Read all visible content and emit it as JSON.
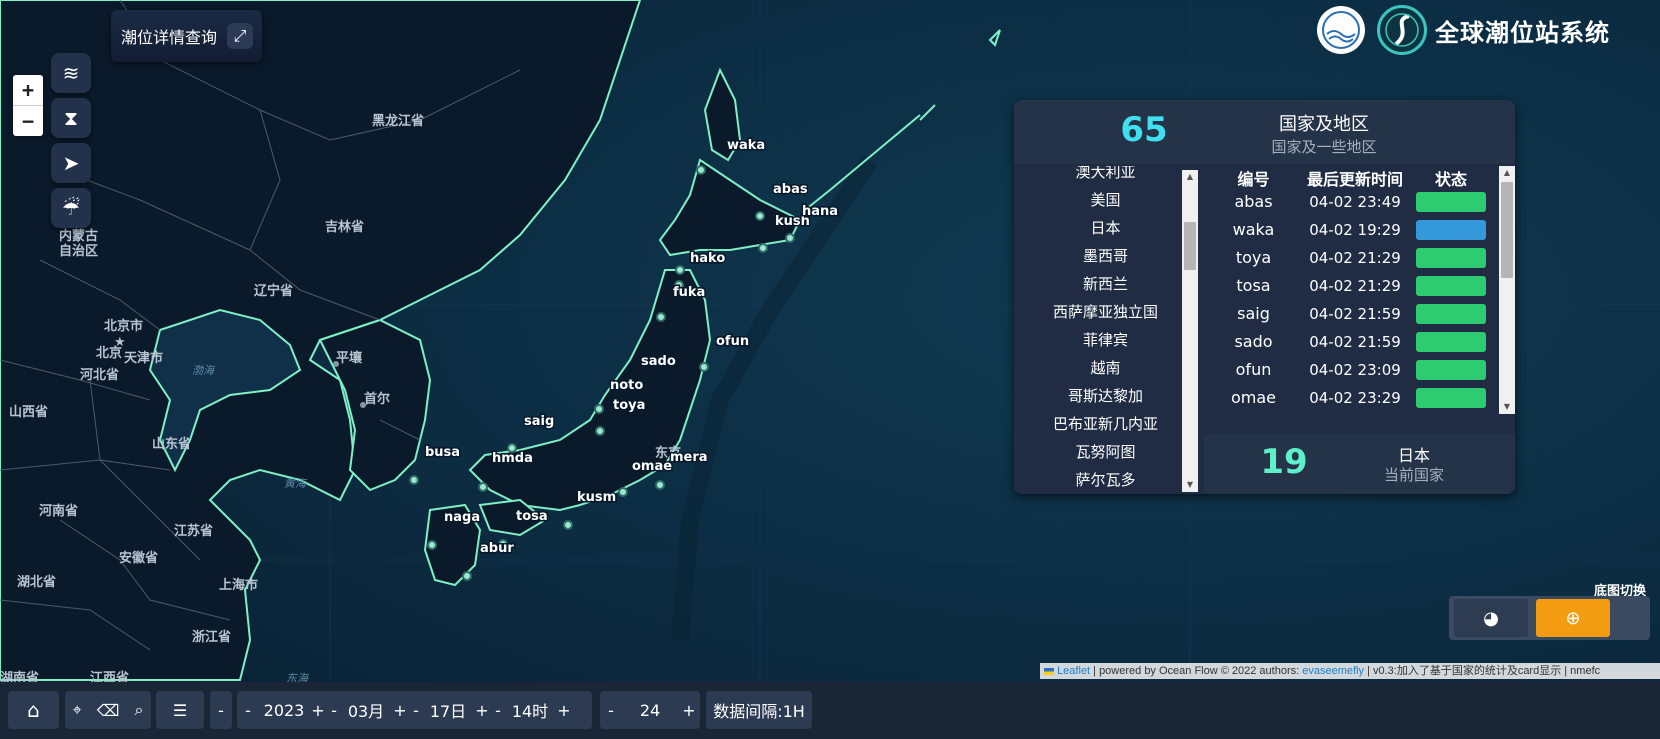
{
  "detail_button": {
    "label": "潮位详情查询",
    "icon": "expand-icon"
  },
  "zoom": {
    "in": "+",
    "out": "−"
  },
  "tools": [
    {
      "name": "tide-layer-icon",
      "glyph": "≋"
    },
    {
      "name": "hourglass-icon",
      "glyph": "⧗"
    },
    {
      "name": "navigate-icon",
      "glyph": "➤"
    },
    {
      "name": "typhoon-icon",
      "glyph": "☔"
    }
  ],
  "logo": {
    "title": "全球潮位站系统"
  },
  "places": {
    "heilongjiang": "黑龙江省",
    "jilin": "吉林省",
    "liaoning": "辽宁省",
    "neimenggu_1": "内蒙古",
    "neimenggu_2": "自治区",
    "beijing_city": "北京市",
    "beijing": "北京",
    "tianjin": "天津市",
    "hebei": "河北省",
    "shanxi": "山西省",
    "shandong": "山东省",
    "henan": "河南省",
    "jiangsu": "江苏省",
    "anhui": "安徽省",
    "hubei": "湖北省",
    "shanghai": "上海市",
    "zhejiang": "浙江省",
    "hunan": "湖南省",
    "jiangxi": "江西省",
    "pyongyang": "平壤",
    "seoul": "首尔",
    "tokyo": "东京",
    "bohai": "渤海",
    "huanghai": "黄海",
    "donghai": "东海"
  },
  "stations": [
    {
      "code": "waka"
    },
    {
      "code": "abas"
    },
    {
      "code": "kush"
    },
    {
      "code": "hana"
    },
    {
      "code": "hako"
    },
    {
      "code": "fuka"
    },
    {
      "code": "ofun"
    },
    {
      "code": "sado"
    },
    {
      "code": "noto"
    },
    {
      "code": "toya"
    },
    {
      "code": "saig"
    },
    {
      "code": "busa"
    },
    {
      "code": "hmda"
    },
    {
      "code": "mera"
    },
    {
      "code": "omae"
    },
    {
      "code": "kusm"
    },
    {
      "code": "naga"
    },
    {
      "code": "tosa"
    },
    {
      "code": "abur"
    }
  ],
  "panel": {
    "country_count": "65",
    "country_title": "国家及地区",
    "country_sub": "国家及一些地区",
    "countries": [
      "澳大利亚",
      "美国",
      "日本",
      "墨西哥",
      "新西兰",
      "西萨摩亚独立国",
      "菲律宾",
      "越南",
      "哥斯达黎加",
      "巴布亚新几内亚",
      "瓦努阿图",
      "萨尔瓦多"
    ],
    "headers": {
      "code": "编号",
      "time": "最后更新时间",
      "status": "状态"
    },
    "rows": [
      {
        "code": "abas",
        "time": "04-02 23:49",
        "status": "normal"
      },
      {
        "code": "waka",
        "time": "04-02 19:29",
        "status": "selected"
      },
      {
        "code": "toya",
        "time": "04-02 21:29",
        "status": "normal"
      },
      {
        "code": "tosa",
        "time": "04-02 21:29",
        "status": "normal"
      },
      {
        "code": "saig",
        "time": "04-02 21:59",
        "status": "normal"
      },
      {
        "code": "sado",
        "time": "04-02 21:59",
        "status": "normal"
      },
      {
        "code": "ofun",
        "time": "04-02 23:09",
        "status": "normal"
      },
      {
        "code": "omae",
        "time": "04-02 23:29",
        "status": "normal"
      }
    ],
    "status_colors": {
      "normal": "#2ecc71",
      "selected": "#3498db"
    },
    "station_count": "19",
    "current_country": "日本",
    "current_country_label": "当前国家"
  },
  "basemap": {
    "label": "底图切换",
    "options": [
      "globe-dark-icon",
      "globe-icon"
    ],
    "active_color": "#f39c12"
  },
  "attribution": {
    "leaflet": "Leaflet",
    "text1": " | powered by Ocean Flow © 2022 authors: ",
    "author": "evaseemefly",
    "text2": " | v0.3:加入了基于国家的统计及card显示 | nmefc"
  },
  "toolbar": {
    "year": "2023",
    "month": "03月",
    "day": "17日",
    "hour": "14时",
    "interval": "24",
    "interval_text": "数据间隔:1H",
    "minus": "-",
    "plus": "+"
  }
}
